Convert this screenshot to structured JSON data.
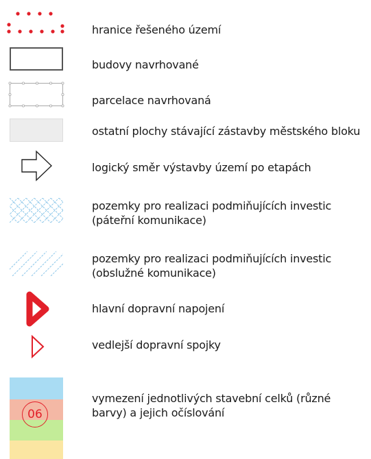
{
  "legend": {
    "items": [
      {
        "id": "boundary",
        "label": "hranice řešeného území",
        "color": "#e2202a"
      },
      {
        "id": "buildings",
        "label": "budovy navrhované",
        "color": "#555555"
      },
      {
        "id": "parcels",
        "label": "parcelace navrhovaná",
        "color": "#9a9a9a"
      },
      {
        "id": "other-areas",
        "label": "ostatní plochy stávající zástavby městského bloku",
        "color": "#ededed"
      },
      {
        "id": "direction",
        "label": "logický směr výstavby území po etapách",
        "color": "#222222"
      },
      {
        "id": "backbone",
        "label_lines": [
          "pozemky pro realizaci podmiňujících investic",
          "(páteřní komunikace)"
        ],
        "color": "#8fc8ea"
      },
      {
        "id": "service",
        "label_lines": [
          "pozemky pro realizaci podmiňujících investic",
          "(obslužné komunikace)"
        ],
        "color": "#8fc8ea"
      },
      {
        "id": "main-connection",
        "label": "hlavní dopravní napojení",
        "color": "#e2202a"
      },
      {
        "id": "side-connection",
        "label": "vedlejší dopravní spojky",
        "color": "#e2202a"
      },
      {
        "id": "units",
        "label_lines": [
          "vymezení jednotlivých stavební celků (různé",
          "barvy) a jejich očíslování"
        ],
        "number": "06",
        "colors": [
          "#a9dcf3",
          "#f4b8a5",
          "#c3ec98",
          "#fbe6a2"
        ]
      }
    ]
  }
}
